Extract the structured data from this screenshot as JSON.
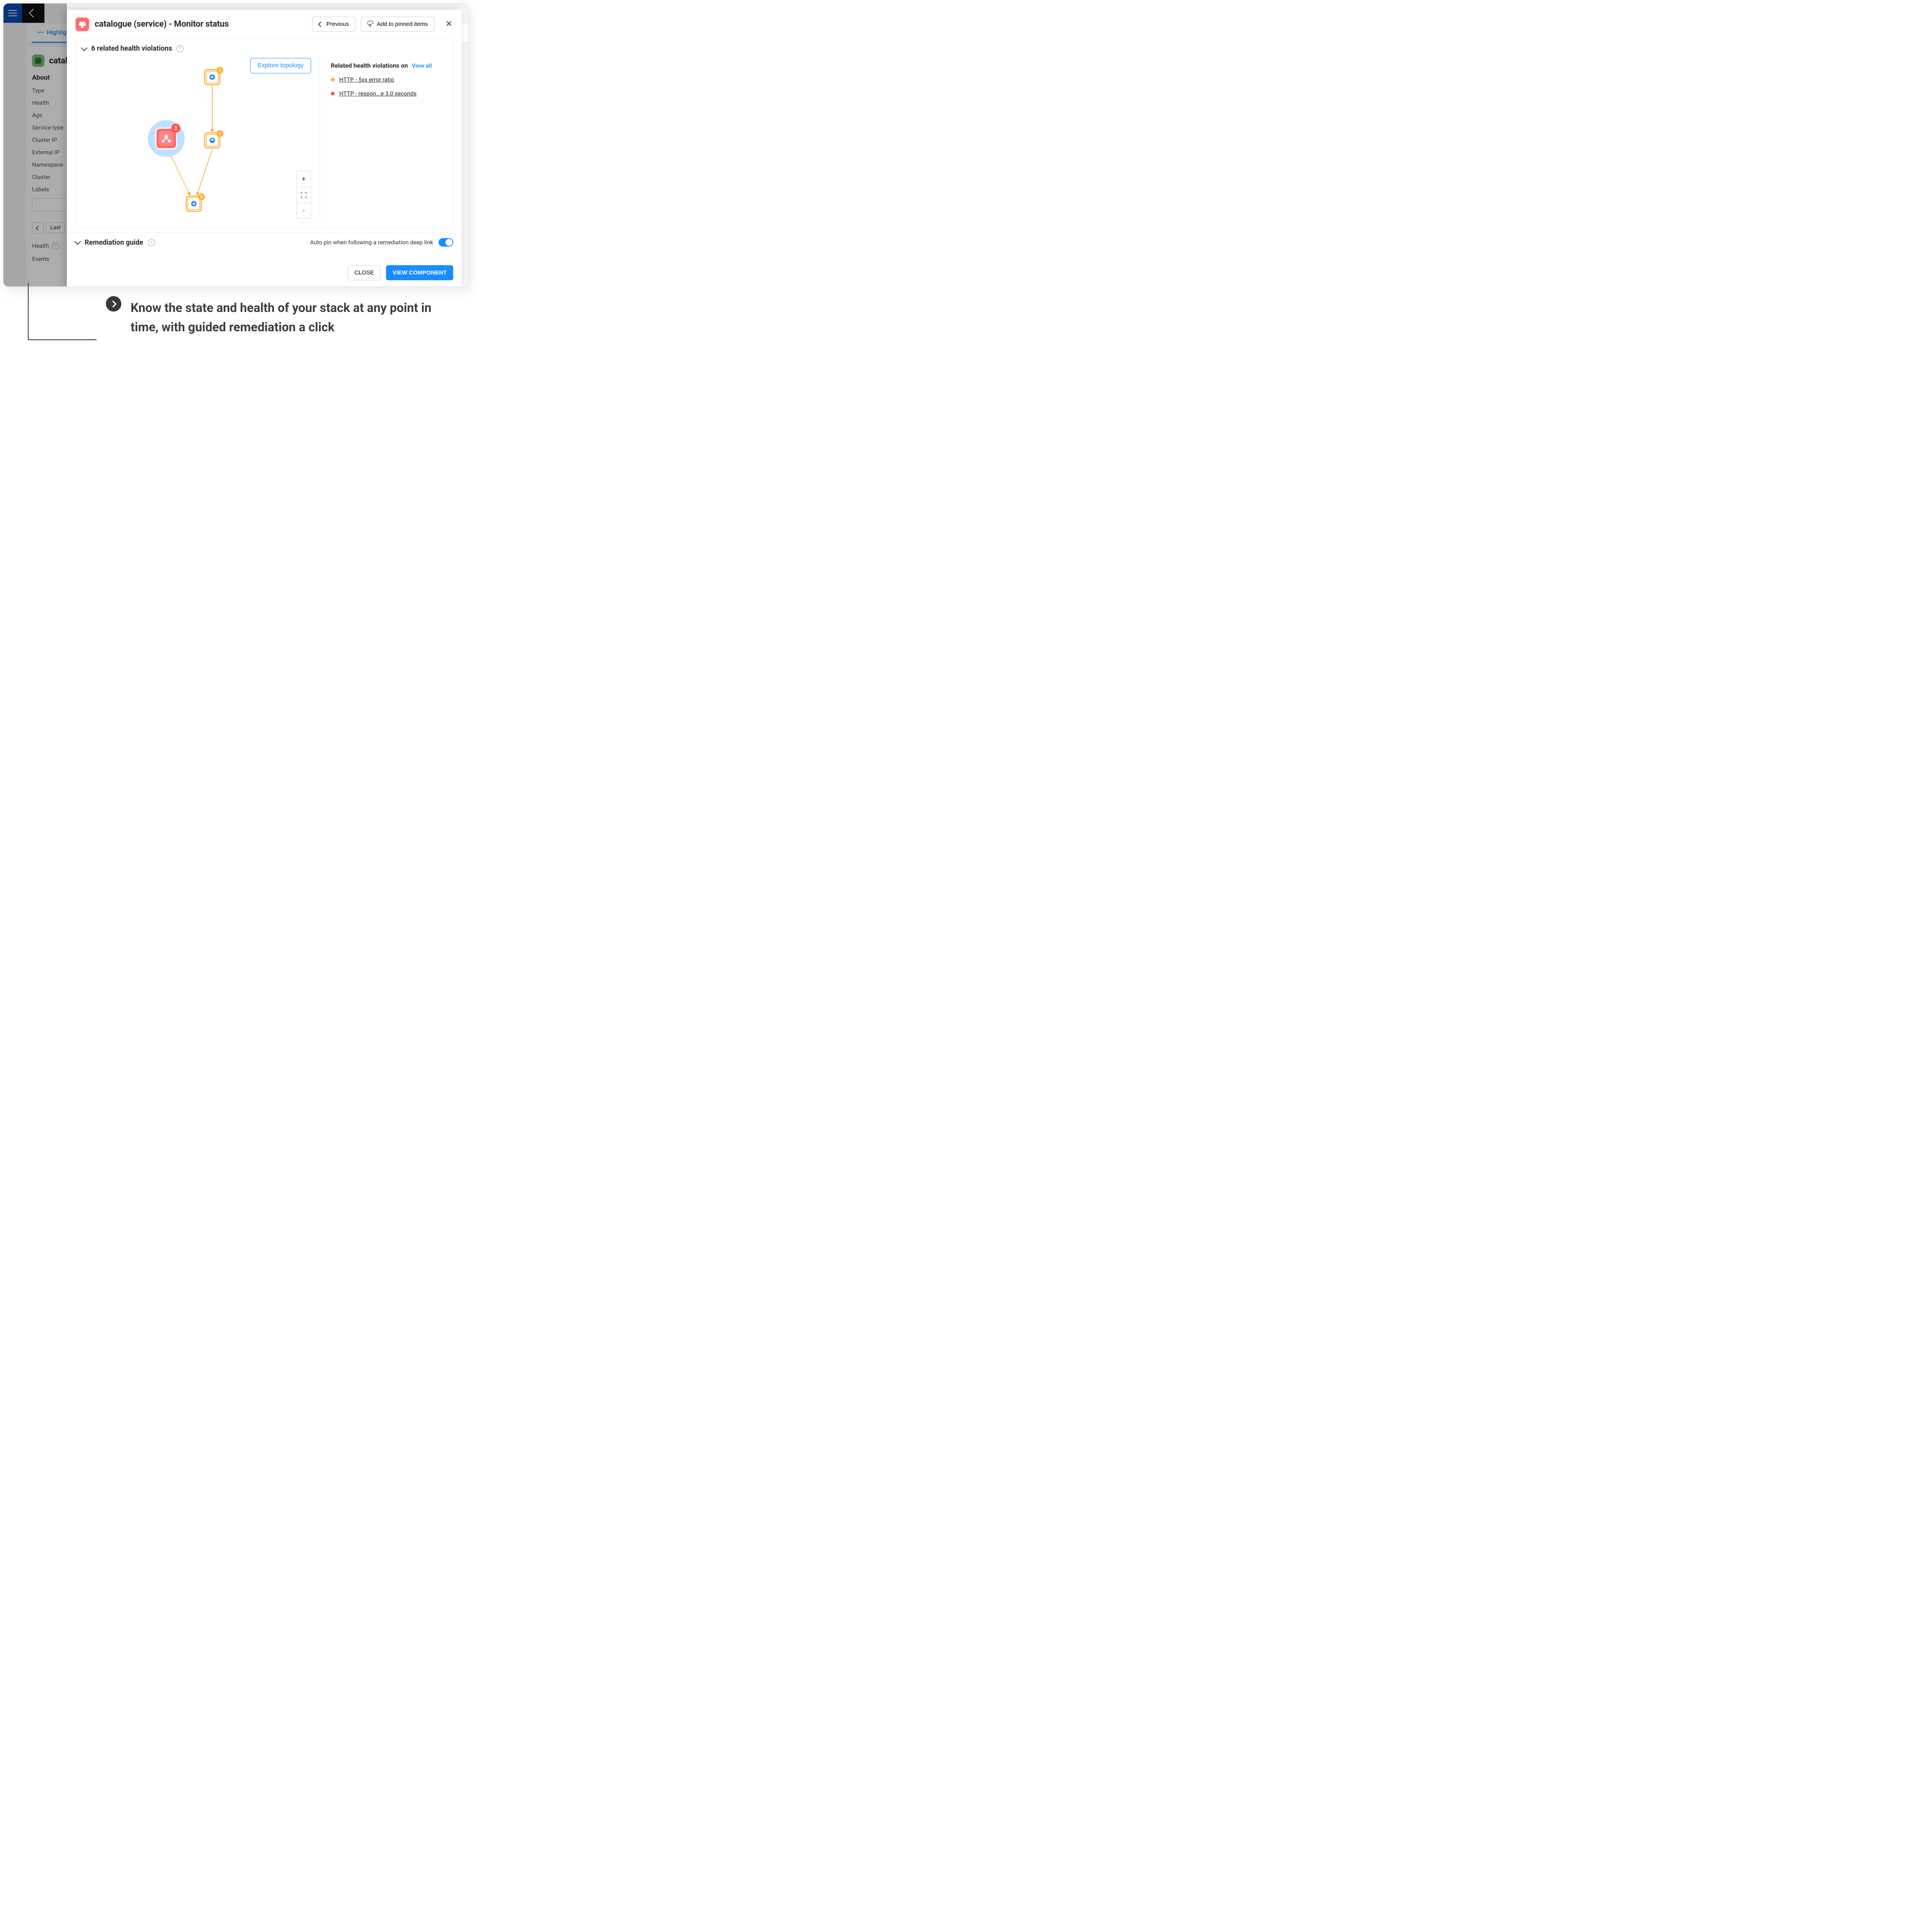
{
  "app": {
    "tab_highlights": "Highlights",
    "entity_name": "catal",
    "about_heading": "About",
    "fields": [
      "Type",
      "Health",
      "Age",
      "Service type",
      "Cluster IP",
      "External IP",
      "Namespace",
      "Cluster",
      "Labels"
    ],
    "filter_last": "Last",
    "section_health": "Health",
    "section_events": "Events"
  },
  "panel": {
    "title": "catalogue (service) - Monitor status",
    "prev": "Previous",
    "pin": "Add to pinned items",
    "violations_title": "6 related health violations",
    "explore": "Explore topology",
    "right_title": "Related health violations on",
    "view_all": "View all",
    "violations": [
      {
        "color": "orange",
        "label": "HTTP - 5xx error ratio"
      },
      {
        "color": "red",
        "label": "HTTP - respon...e 3.0 seconds"
      }
    ],
    "remediation_title": "Remediation guide",
    "auto_pin": "Auto pin when following a remediation deep link",
    "close": "CLOSE",
    "view_component": "VIEW COMPONENT"
  },
  "caption": "Know the state and health of your stack at any point in time, with guided remediation a click"
}
